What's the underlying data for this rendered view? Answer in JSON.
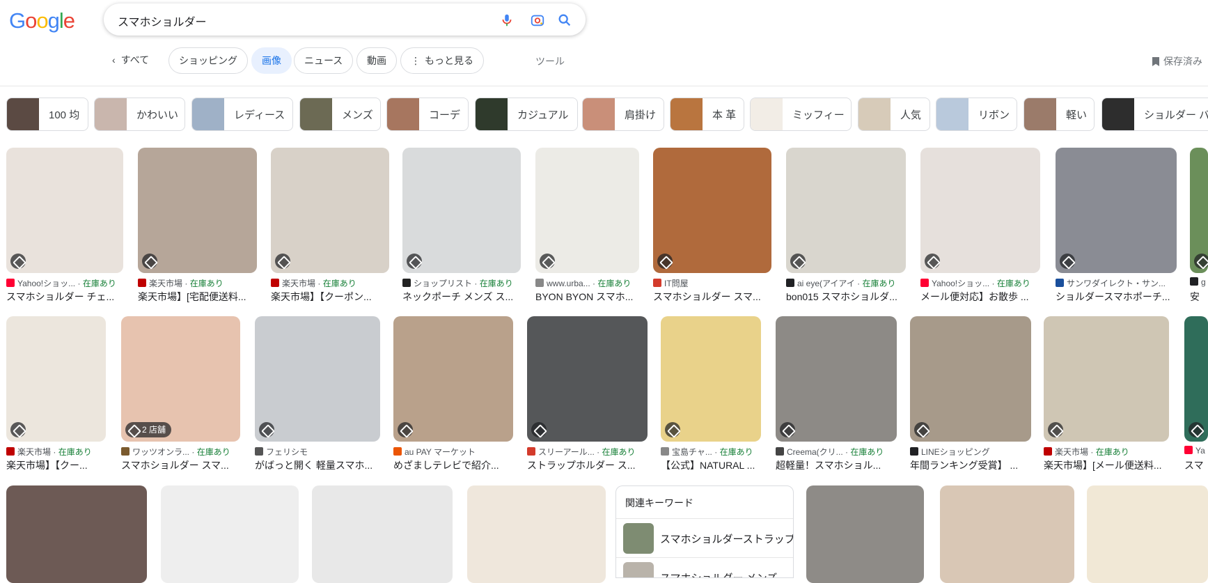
{
  "logo": {
    "letters": [
      "G",
      "o",
      "o",
      "g",
      "l",
      "e"
    ],
    "colors": [
      "#4285f4",
      "#ea4335",
      "#fbbc05",
      "#4285f4",
      "#34a853",
      "#ea4335"
    ]
  },
  "search": {
    "query": "スマホショルダー",
    "icons": [
      "mic-icon",
      "lens-icon",
      "search-icon"
    ]
  },
  "nav": {
    "back": "すべて",
    "tabs": [
      "ショッピング",
      "画像",
      "ニュース",
      "動画",
      "もっと見る"
    ],
    "active_tab": "画像",
    "tools": "ツール",
    "saved": "保存済み"
  },
  "filters": [
    {
      "label": "100 均",
      "color": "#5b4a43"
    },
    {
      "label": "かわいい",
      "color": "#c9b6ad"
    },
    {
      "label": "レディース",
      "color": "#9fb1c7"
    },
    {
      "label": "メンズ",
      "color": "#6c6a54"
    },
    {
      "label": "コーデ",
      "color": "#a7765f"
    },
    {
      "label": "カジュアル",
      "color": "#2f3a2c"
    },
    {
      "label": "肩掛け",
      "color": "#c98f79"
    },
    {
      "label": "本 革",
      "color": "#b9753f"
    },
    {
      "label": "ミッフィー",
      "color": "#f2ede6"
    },
    {
      "label": "人気",
      "color": "#d7cbb9"
    },
    {
      "label": "リボン",
      "color": "#b9c9dc"
    },
    {
      "label": "軽い",
      "color": "#9b7b6a"
    },
    {
      "label": "ショルダー バッグ",
      "color": "#2d2d2d"
    }
  ],
  "row1": [
    {
      "source": "Yahoo!ショッ...",
      "stock": "在庫あり",
      "title": "スマホショルダー チェ...",
      "color": "#e9e2dc",
      "fav": "#ff0033"
    },
    {
      "source": "楽天市場",
      "stock": "在庫あり",
      "title": "楽天市場】[宅配便送料...",
      "color": "#b6a699",
      "fav": "#bf0000"
    },
    {
      "source": "楽天市場",
      "stock": "在庫あり",
      "title": "楽天市場】【クーポン...",
      "color": "#d8d1c8",
      "fav": "#bf0000"
    },
    {
      "source": "ショップリスト",
      "stock": "在庫あり",
      "title": "ネックポーチ メンズ ス...",
      "color": "#d9dbdc",
      "fav": "#222222"
    },
    {
      "source": "www.urba...",
      "stock": "在庫あり",
      "title": "BYON BYON スマホ...",
      "color": "#ecebe6",
      "fav": "#888888"
    },
    {
      "source": "IT問屋",
      "stock": "",
      "title": "スマホショルダー スマ...",
      "color": "#b06a3c",
      "fav": "#d33b2c"
    },
    {
      "source": "ai eye(アイアイ",
      "stock": "在庫あり",
      "title": "bon015 スマホショルダ...",
      "color": "#d9d6ce",
      "fav": "#202124"
    },
    {
      "source": "Yahoo!ショッ...",
      "stock": "在庫あり",
      "title": "メール便対応】お散歩 ...",
      "color": "#e6e0dc",
      "fav": "#ff0033"
    },
    {
      "source": "サンワダイレクト・サン...",
      "stock": "",
      "title": "ショルダースマホポーチ...",
      "color": "#8a8c94",
      "fav": "#1a4f9c"
    },
    {
      "source": "g",
      "stock": "",
      "title": "安",
      "color": "#6b8f5a",
      "fav": "#202124"
    }
  ],
  "row2": [
    {
      "source": "楽天市場",
      "stock": "在庫あり",
      "title": "楽天市場】【クー...",
      "color": "#ece6dd",
      "fav": "#bf0000",
      "badge": ""
    },
    {
      "source": "ワッツオンラ...",
      "stock": "在庫あり",
      "title": "スマホショルダー スマ...",
      "color": "#e7c3af",
      "fav": "#7a5a2e",
      "badge": "2 店舗"
    },
    {
      "source": "フェリシモ",
      "stock": "",
      "title": "がばっと開く 軽量スマホ...",
      "color": "#c9ccd0",
      "fav": "#555555",
      "badge": ""
    },
    {
      "source": "au PAY マーケット",
      "stock": "",
      "title": "めざましテレビで紹介...",
      "color": "#b9a18b",
      "fav": "#eb5505",
      "badge": ""
    },
    {
      "source": "スリーアール...",
      "stock": "在庫あり",
      "title": "ストラップホルダー ス...",
      "color": "#555759",
      "fav": "#d33b2c",
      "badge": ""
    },
    {
      "source": "宝島チャ...",
      "stock": "在庫あり",
      "title": "【公式】NATURAL ...",
      "color": "#e9d28a",
      "fav": "#888888",
      "badge": ""
    },
    {
      "source": "Creema(クリ...",
      "stock": "在庫あり",
      "title": "超軽量！スマホショル...",
      "color": "#8d8a86",
      "fav": "#444444",
      "badge": ""
    },
    {
      "source": "LINEショッピング",
      "stock": "",
      "title": "年間ランキング受賞】 ...",
      "color": "#a79a8a",
      "fav": "#202124",
      "badge": ""
    },
    {
      "source": "楽天市場",
      "stock": "在庫あり",
      "title": "楽天市場】[メール便送料...",
      "color": "#cfc6b4",
      "fav": "#bf0000",
      "badge": ""
    },
    {
      "source": "Ya",
      "stock": "",
      "title": "スマ",
      "color": "#2f6d5a",
      "fav": "#ff0033",
      "badge": ""
    }
  ],
  "row3": [
    {
      "color": "#6d5a55"
    },
    {
      "color": "#eeeeee"
    },
    {
      "color": "#e8e8e8"
    },
    {
      "color": "#efe7dc"
    },
    {
      "color": "#8e8b87"
    },
    {
      "color": "#d9c7b5"
    },
    {
      "color": "#f1e8d6"
    }
  ],
  "keywords": {
    "heading": "関連キーワード",
    "items": [
      {
        "label": "スマホショルダーストラップ",
        "color": "#7e8c72"
      },
      {
        "label": "スマホショルダー メンズ",
        "color": "#b9b3aa"
      }
    ]
  }
}
